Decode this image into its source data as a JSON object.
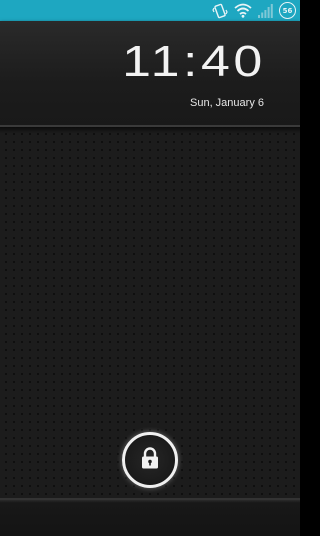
{
  "status_bar": {
    "background_color": "#1ea7c1",
    "icons": [
      "vibrate-icon",
      "wifi-icon",
      "signal-icon",
      "battery-icon"
    ],
    "battery_level": "56"
  },
  "clock": {
    "time": "11:40",
    "date": "Sun, January 6"
  },
  "unlock": {
    "icon": "lock-icon"
  }
}
